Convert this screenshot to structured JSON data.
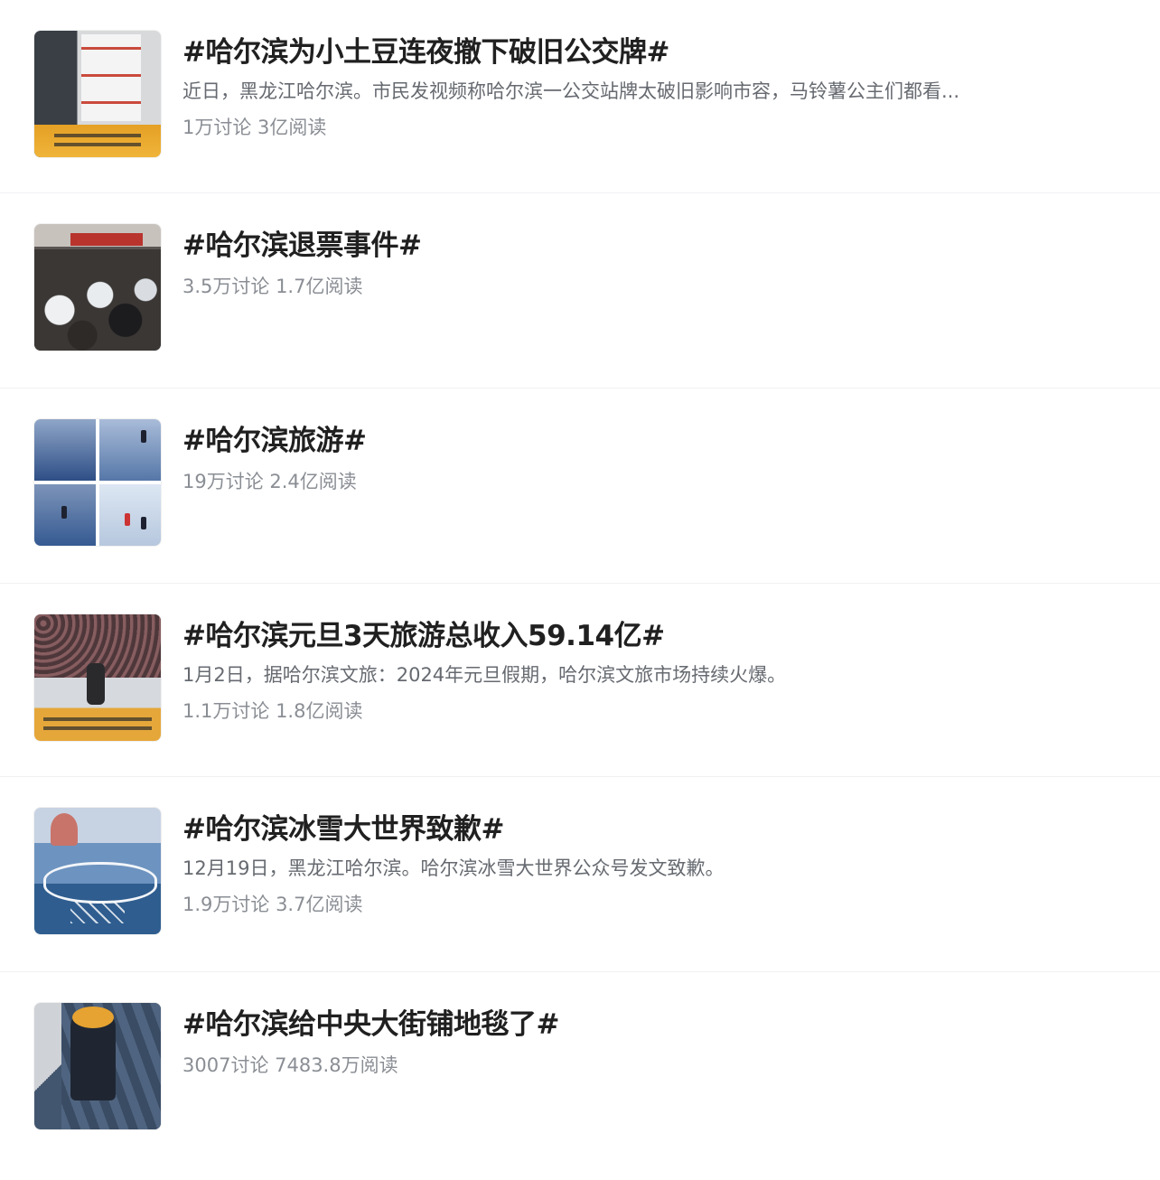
{
  "topics": [
    {
      "title": "#哈尔滨为小土豆连夜撤下破旧公交牌#",
      "desc": "近日，黑龙江哈尔滨。市民发视频称哈尔滨一公交站牌太破旧影响市容，马铃薯公主们都看...",
      "stats": "1万讨论 3亿阅读",
      "thumb_icon": "bus-stop-sign-photo"
    },
    {
      "title": "#哈尔滨退票事件#",
      "desc": "",
      "stats": "3.5万讨论 1.7亿阅读",
      "thumb_icon": "crowd-photo"
    },
    {
      "title": "#哈尔滨旅游#",
      "desc": "",
      "stats": "19万讨论 2.4亿阅读",
      "thumb_icon": "ice-rink-collage-photo"
    },
    {
      "title": "#哈尔滨元旦3天旅游总收入59.14亿#",
      "desc": "1月2日，据哈尔滨文旅：2024年元旦假期，哈尔滨文旅市场持续火爆。",
      "stats": "1.1万讨论 1.8亿阅读",
      "thumb_icon": "ice-skating-show-photo"
    },
    {
      "title": "#哈尔滨冰雪大世界致歉#",
      "desc": "12月19日，黑龙江哈尔滨。哈尔滨冰雪大世界公众号发文致歉。",
      "stats": "1.9万讨论 3.7亿阅读",
      "thumb_icon": "ice-snow-world-photo"
    },
    {
      "title": "#哈尔滨给中央大街铺地毯了#",
      "desc": "",
      "stats": "3007讨论 7483.8万阅读",
      "thumb_icon": "carpet-street-photo"
    }
  ]
}
